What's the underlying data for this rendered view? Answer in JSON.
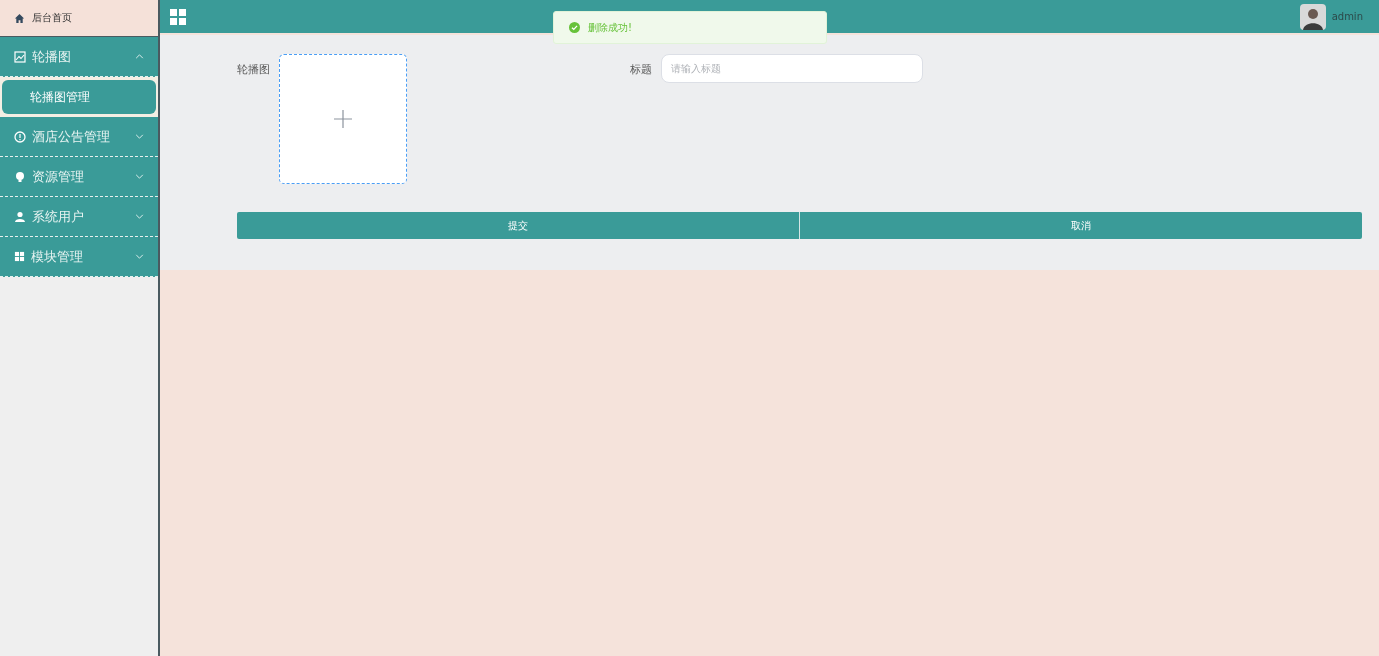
{
  "sidebar": {
    "home": {
      "label": "后台首页"
    },
    "menus": [
      {
        "label": "轮播图",
        "expanded": true,
        "children": [
          {
            "label": "轮播图管理",
            "selected": true
          }
        ]
      },
      {
        "label": "酒店公告管理",
        "expanded": false
      },
      {
        "label": "资源管理",
        "expanded": false
      },
      {
        "label": "系统用户",
        "expanded": false
      },
      {
        "label": "模块管理",
        "expanded": false
      }
    ]
  },
  "header": {
    "user": "admin"
  },
  "toast": {
    "message": "删除成功!"
  },
  "form": {
    "upload_label": "轮播图",
    "title_label": "标题",
    "title_placeholder": "请输入标题",
    "buttons": [
      "提交",
      "取消"
    ]
  }
}
